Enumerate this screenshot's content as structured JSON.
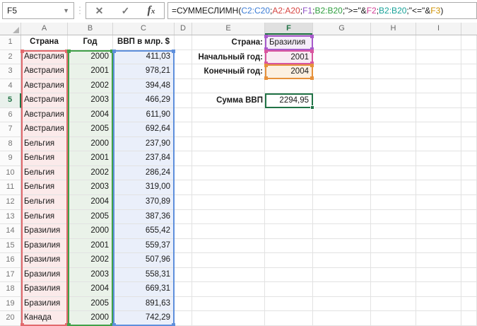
{
  "name_box": "F5",
  "formula_bar": {
    "formula": "=СУММЕСЛИМН(C2:C20;A2:A20;F1;B2:B20;\">=\"&F2;B2:B20;\"<=\"&F3)",
    "segments": [
      {
        "text": "=СУММЕСЛИМН(",
        "color": "#1a1a1a"
      },
      {
        "text": "C2:C20",
        "color": "#3A7BD5"
      },
      {
        "text": ";",
        "color": "#1a1a1a"
      },
      {
        "text": "A2:A20",
        "color": "#D64541"
      },
      {
        "text": ";",
        "color": "#1a1a1a"
      },
      {
        "text": "F1",
        "color": "#8E4EC6"
      },
      {
        "text": ";",
        "color": "#1a1a1a"
      },
      {
        "text": "B2:B20",
        "color": "#2E9E3E"
      },
      {
        "text": ";\">=\"&",
        "color": "#1a1a1a"
      },
      {
        "text": "F2",
        "color": "#D23F97"
      },
      {
        "text": ";",
        "color": "#1a1a1a"
      },
      {
        "text": "B2:B20",
        "color": "#17A298"
      },
      {
        "text": ";\"<=\"&",
        "color": "#1a1a1a"
      },
      {
        "text": "F3",
        "color": "#CE9103"
      },
      {
        "text": ")",
        "color": "#1a1a1a"
      }
    ]
  },
  "sheet": {
    "columns": [
      "A",
      "B",
      "C",
      "D",
      "E",
      "F",
      "G",
      "H",
      "I"
    ],
    "header_row": {
      "num": "1",
      "country": "Страна",
      "year": "Год",
      "gdp": "ВВП в млр. $"
    },
    "data_rows": [
      {
        "num": "2",
        "country": "Австралия",
        "year": "2000",
        "gdp": "411,03"
      },
      {
        "num": "3",
        "country": "Австралия",
        "year": "2001",
        "gdp": "978,21"
      },
      {
        "num": "4",
        "country": "Австралия",
        "year": "2002",
        "gdp": "394,48"
      },
      {
        "num": "5",
        "country": "Австралия",
        "year": "2003",
        "gdp": "466,29"
      },
      {
        "num": "6",
        "country": "Австралия",
        "year": "2004",
        "gdp": "611,90"
      },
      {
        "num": "7",
        "country": "Австралия",
        "year": "2005",
        "gdp": "692,64"
      },
      {
        "num": "8",
        "country": "Бельгия",
        "year": "2000",
        "gdp": "237,90"
      },
      {
        "num": "9",
        "country": "Бельгия",
        "year": "2001",
        "gdp": "237,84"
      },
      {
        "num": "10",
        "country": "Бельгия",
        "year": "2002",
        "gdp": "286,24"
      },
      {
        "num": "11",
        "country": "Бельгия",
        "year": "2003",
        "gdp": "319,00"
      },
      {
        "num": "12",
        "country": "Бельгия",
        "year": "2004",
        "gdp": "370,89"
      },
      {
        "num": "13",
        "country": "Бельгия",
        "year": "2005",
        "gdp": "387,36"
      },
      {
        "num": "14",
        "country": "Бразилия",
        "year": "2000",
        "gdp": "655,42"
      },
      {
        "num": "15",
        "country": "Бразилия",
        "year": "2001",
        "gdp": "559,37"
      },
      {
        "num": "16",
        "country": "Бразилия",
        "year": "2002",
        "gdp": "507,96"
      },
      {
        "num": "17",
        "country": "Бразилия",
        "year": "2003",
        "gdp": "558,31"
      },
      {
        "num": "18",
        "country": "Бразилия",
        "year": "2004",
        "gdp": "669,31"
      },
      {
        "num": "19",
        "country": "Бразилия",
        "year": "2005",
        "gdp": "891,63"
      },
      {
        "num": "20",
        "country": "Канада",
        "year": "2000",
        "gdp": "742,29"
      }
    ]
  },
  "panel": {
    "country_label": "Страна:",
    "country_value": "Бразилия",
    "start_label": "Начальный год:",
    "start_value": "2001",
    "end_label": "Конечный год:",
    "end_value": "2004",
    "sum_label": "Сумма ВВП",
    "sum_value": "2294,95"
  },
  "selection": {
    "active_cell": "F5",
    "active_row_num": "5",
    "active_col": "F"
  },
  "colors": {
    "range_a_border": "#E2696D",
    "range_a_fill": "#FBEAEA",
    "range_b_border": "#41A049",
    "range_b_fill": "#EAF2E9",
    "range_c_border": "#5E8FDC",
    "range_c_fill": "#EAEFFA",
    "box_f1_border": "#A75ACB",
    "box_f1_fill": "#F5EDF9",
    "box_f2_border": "#D8559F",
    "box_f2_fill": "#F9EBF3",
    "box_f3_border": "#E6913B",
    "box_f3_fill": "#FCF0E1",
    "active_border": "#217346"
  }
}
